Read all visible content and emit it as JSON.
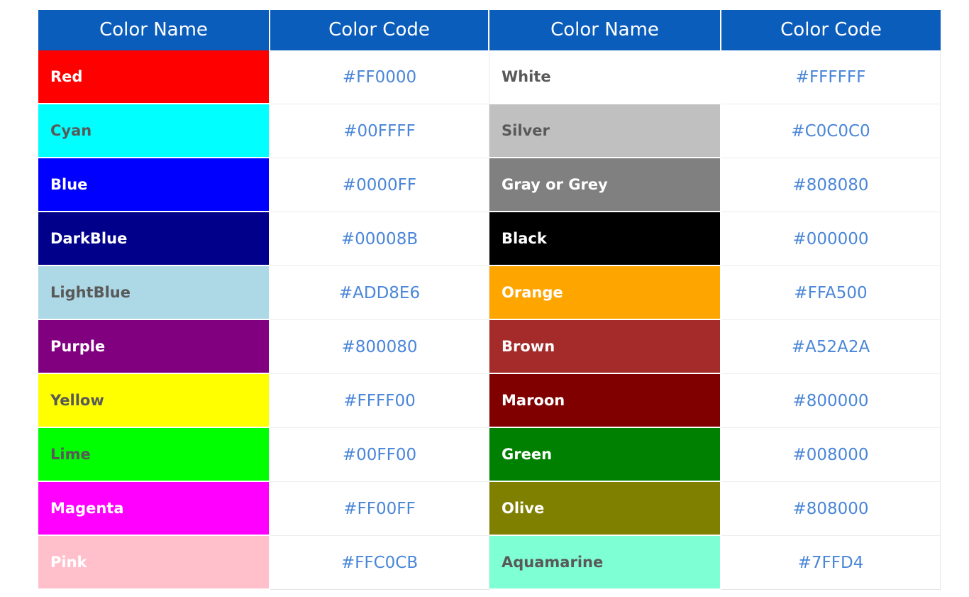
{
  "table": {
    "headers": [
      "Color Name",
      "Color Code",
      "Color Name",
      "Color Code"
    ],
    "header_bg": "#0B5DBC",
    "header_text_color": "#FFFFFF",
    "code_text_color": "#4A86D8",
    "rows": [
      {
        "left": {
          "name": "Red",
          "code": "#FF0000",
          "bg": "#FF0000",
          "fg": "#FFFFFF"
        },
        "right": {
          "name": "White",
          "code": "#FFFFFF",
          "bg": "#FFFFFF",
          "fg": "#595959"
        }
      },
      {
        "left": {
          "name": "Cyan",
          "code": "#00FFFF",
          "bg": "#00FFFF",
          "fg": "#595959"
        },
        "right": {
          "name": "Silver",
          "code": "#C0C0C0",
          "bg": "#C0C0C0",
          "fg": "#595959"
        }
      },
      {
        "left": {
          "name": "Blue",
          "code": "#0000FF",
          "bg": "#0000FF",
          "fg": "#FFFFFF"
        },
        "right": {
          "name": "Gray or Grey",
          "code": "#808080",
          "bg": "#808080",
          "fg": "#FFFFFF"
        }
      },
      {
        "left": {
          "name": "DarkBlue",
          "code": "#00008B",
          "bg": "#00008B",
          "fg": "#FFFFFF"
        },
        "right": {
          "name": "Black",
          "code": "#000000",
          "bg": "#000000",
          "fg": "#FFFFFF"
        }
      },
      {
        "left": {
          "name": "LightBlue",
          "code": "#ADD8E6",
          "bg": "#ADD8E6",
          "fg": "#595959"
        },
        "right": {
          "name": "Orange",
          "code": "#FFA500",
          "bg": "#FFA500",
          "fg": "#FFFFFF"
        }
      },
      {
        "left": {
          "name": "Purple",
          "code": "#800080",
          "bg": "#800080",
          "fg": "#FFFFFF"
        },
        "right": {
          "name": "Brown",
          "code": "#A52A2A",
          "bg": "#A52A2A",
          "fg": "#FFFFFF"
        }
      },
      {
        "left": {
          "name": "Yellow",
          "code": "#FFFF00",
          "bg": "#FFFF00",
          "fg": "#595959"
        },
        "right": {
          "name": "Maroon",
          "code": "#800000",
          "bg": "#800000",
          "fg": "#FFFFFF"
        }
      },
      {
        "left": {
          "name": "Lime",
          "code": "#00FF00",
          "bg": "#00FF00",
          "fg": "#595959"
        },
        "right": {
          "name": "Green",
          "code": "#008000",
          "bg": "#008000",
          "fg": "#FFFFFF"
        }
      },
      {
        "left": {
          "name": "Magenta",
          "code": "#FF00FF",
          "bg": "#FF00FF",
          "fg": "#FFFFFF"
        },
        "right": {
          "name": "Olive",
          "code": "#808000",
          "bg": "#808000",
          "fg": "#FFFFFF"
        }
      },
      {
        "left": {
          "name": "Pink",
          "code": "#FFC0CB",
          "bg": "#FFC0CB",
          "fg": "#FFFFFF"
        },
        "right": {
          "name": "Aquamarine",
          "code": "#7FFD4",
          "bg": "#7FFFD4",
          "fg": "#595959"
        }
      }
    ]
  }
}
